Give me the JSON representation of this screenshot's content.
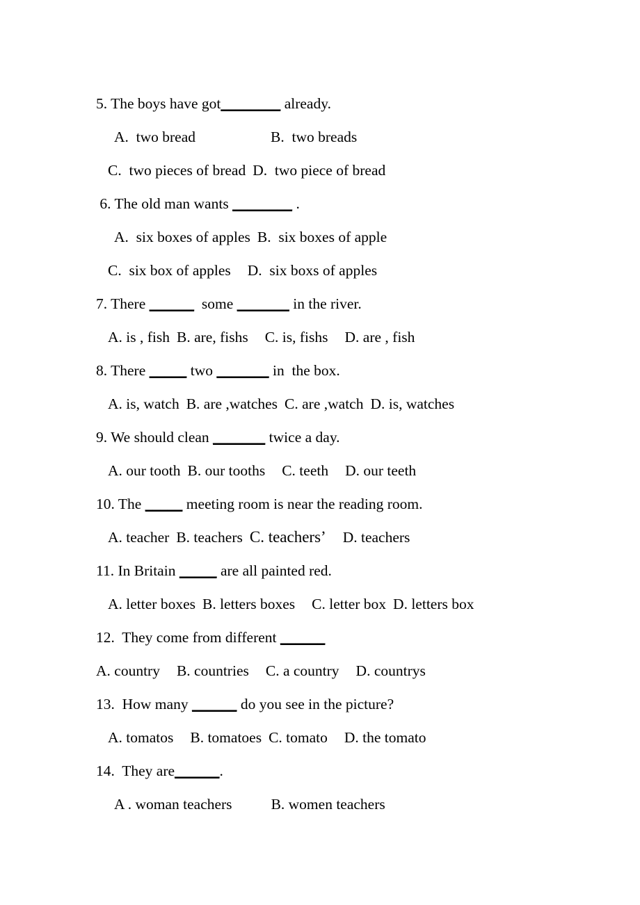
{
  "document": {
    "type": "english-grammar-worksheet",
    "page_background": "#ffffff",
    "text_color": "#000000"
  },
  "questions": [
    {
      "number": "5.",
      "stem_before": "5. The boys have got",
      "blank": "________",
      "stem_after": " already.",
      "option_rows": [
        {
          "left": "A.  two bread",
          "right": "B.  two breads"
        },
        {
          "left": "C.  two pieces of bread",
          "right": "D.  two piece of bread"
        }
      ]
    },
    {
      "number": "6.",
      "stem_before": " 6. The old man wants ",
      "blank": "________",
      "stem_after": " .",
      "option_rows": [
        {
          "left": "A.  six boxes of apples",
          "right": "B.  six boxes of apple"
        },
        {
          "left": "C.  six box of apples",
          "right": "D.  six boxs of apples"
        }
      ]
    },
    {
      "number": "7.",
      "stem_before": "7. There ",
      "blank": "______",
      "stem_mid": "  some ",
      "blank2": "_______",
      "stem_after": " in the river.",
      "options_inline": [
        "A. is , fish",
        "B. are, fishs",
        "C. is, fishs",
        "D. are , fish"
      ]
    },
    {
      "number": "8.",
      "stem_before": "8. There ",
      "blank": "_____",
      "stem_mid": " two ",
      "blank2": "_______",
      "stem_after": " in  the box.",
      "options_inline": [
        "A. is, watch",
        "B. are ,watches",
        "C. are ,watch",
        "D. is, watches"
      ]
    },
    {
      "number": "9.",
      "stem_before": "9. We should clean ",
      "blank": "_______",
      "stem_after": " twice a day.",
      "options_inline": [
        "A. our tooth",
        "B. our tooths",
        "C. teeth",
        "D. our teeth"
      ]
    },
    {
      "number": "10.",
      "stem_before": "10. The ",
      "blank": "_____",
      "stem_after": " meeting room is near the reading room.",
      "options_inline": [
        "A. teacher",
        "B. teachers",
        "C. teachers’",
        "D. teachers"
      ]
    },
    {
      "number": "11.",
      "stem_before": "11. In Britain ",
      "blank": "_____",
      "stem_after": " are all painted red.",
      "options_inline": [
        "A. letter boxes",
        "B. letters boxes",
        "C. letter box",
        "D. letters box"
      ]
    },
    {
      "number": "12.",
      "stem_before": "12.  They come from different ",
      "blank": "______",
      "stem_after": "",
      "options_inline": [
        "A. country",
        "B. countries",
        "C. a country",
        "D. countrys"
      ]
    },
    {
      "number": "13.",
      "stem_before": "13.  How many ",
      "blank": "______",
      "stem_after": " do you see in the picture?",
      "options_inline": [
        "A. tomatos",
        "B. tomatoes",
        "C. tomato",
        "D. the tomato"
      ]
    },
    {
      "number": "14.",
      "stem_before": "14.  They are",
      "blank": "______",
      "stem_after": ".",
      "options_inline": [
        "A . woman teachers",
        "B. women teachers"
      ]
    }
  ]
}
